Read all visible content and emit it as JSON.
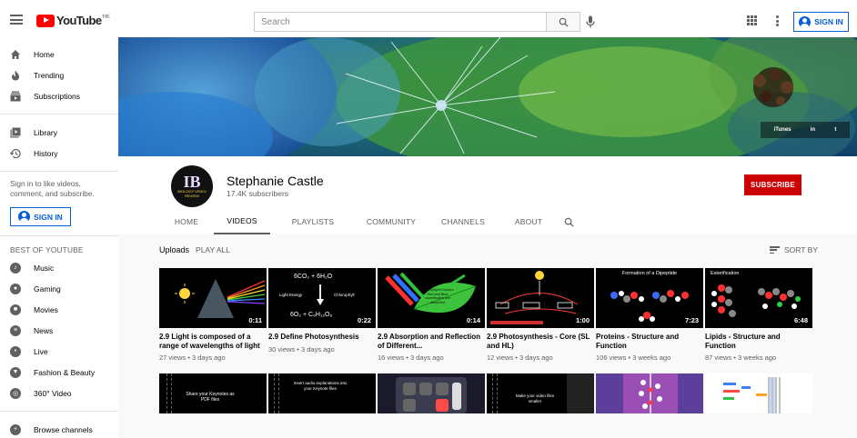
{
  "header": {
    "logo_text": "YouTube",
    "region": "HK",
    "search_placeholder": "Search",
    "signin_label": "SIGN IN"
  },
  "sidebar": {
    "main_items": [
      {
        "label": "Home",
        "icon": "home-icon"
      },
      {
        "label": "Trending",
        "icon": "trending-icon"
      },
      {
        "label": "Subscriptions",
        "icon": "subscriptions-icon"
      }
    ],
    "library_items": [
      {
        "label": "Library",
        "icon": "library-icon"
      },
      {
        "label": "History",
        "icon": "history-icon"
      }
    ],
    "signin_prompt": "Sign in to like videos, comment, and subscribe.",
    "signin_label": "SIGN IN",
    "best_heading": "BEST OF YOUTUBE",
    "best_items": [
      {
        "label": "Music",
        "icon": "music-icon"
      },
      {
        "label": "Gaming",
        "icon": "gaming-icon"
      },
      {
        "label": "Movies",
        "icon": "movies-icon"
      },
      {
        "label": "News",
        "icon": "news-icon"
      },
      {
        "label": "Live",
        "icon": "live-icon"
      },
      {
        "label": "Fashion & Beauty",
        "icon": "fashion-icon"
      },
      {
        "label": "360° Video",
        "icon": "360-video-icon"
      }
    ],
    "browse_label": "Browse channels"
  },
  "banner": {
    "links": [
      "iTunes",
      "in",
      "t"
    ]
  },
  "channel": {
    "name": "Stephanie Castle",
    "subscribers": "17.4K subscribers",
    "avatar_text": "IB",
    "avatar_sub": "BIOLOGY VIDEO REVIEW",
    "subscribe_label": "SUBSCRIBE",
    "tabs": [
      "HOME",
      "VIDEOS",
      "PLAYLISTS",
      "COMMUNITY",
      "CHANNELS",
      "ABOUT"
    ],
    "active_tab": "VIDEOS"
  },
  "content": {
    "section_title": "Uploads",
    "play_all": "PLAY ALL",
    "sort_label": "SORT BY",
    "videos": [
      {
        "title": "2.9 Light is composed of a range of wavelengths of light",
        "meta": "27 views • 3 days ago",
        "duration": "0:11"
      },
      {
        "title": "2.9 Define Photosynthesis",
        "meta": "30 views • 3 days ago",
        "duration": "0:22"
      },
      {
        "title": "2.9 Absorption and Reflection of Different...",
        "meta": "16 views • 3 days ago",
        "duration": "0:14"
      },
      {
        "title": "2.9 Photosynthesis - Core (SL and HL)",
        "meta": "12 views • 3 days ago",
        "duration": "1:00"
      },
      {
        "title": "Proteins - Structure and Function",
        "meta": "106 views • 3 weeks ago",
        "duration": "7:23"
      },
      {
        "title": "Lipids - Structure and Function",
        "meta": "87 views • 3 weeks ago",
        "duration": "6:48"
      }
    ],
    "thumb_text": {
      "v2_top": "6CO₂  +  6H₂O",
      "v2_mid_left": "Light Energy",
      "v2_mid_right": "Chlorophyll",
      "v2_bottom": "6O₂  +  C₆H₁₂O₆",
      "v3_leaf": "Chlorophyll in leaves Red and Blue wavelengths are absorbed",
      "v5_title": "Formation of a Dipeptide",
      "v6_title": "Esterification",
      "r1": "Share your Keynotes as PDF files",
      "r2": "Insert audio explanations into your Keynote files",
      "r4": "Make your video files smaller"
    }
  },
  "colors": {
    "brand_red": "#ff0000",
    "subscribe_red": "#cc0000",
    "signin_blue": "#065fd4"
  }
}
